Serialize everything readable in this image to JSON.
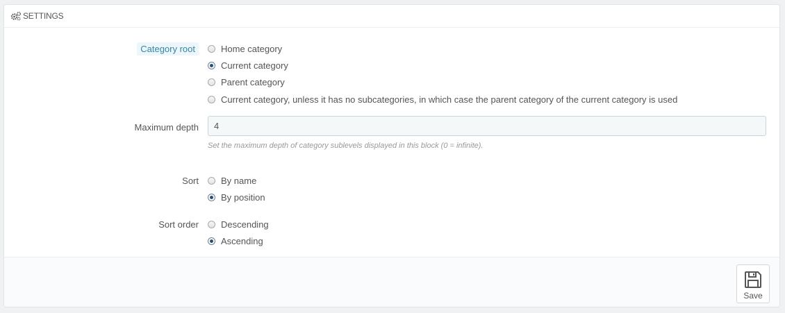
{
  "header": {
    "title": "Settings",
    "icon": "cogs-icon"
  },
  "category_root": {
    "label": "Category root",
    "options": [
      {
        "label": "Home category",
        "checked": false
      },
      {
        "label": "Current category",
        "checked": true
      },
      {
        "label": "Parent category",
        "checked": false
      },
      {
        "label": "Current category, unless it has no subcategories, in which case the parent category of the current category is used",
        "checked": false
      }
    ]
  },
  "max_depth": {
    "label": "Maximum depth",
    "value": "4",
    "help": "Set the maximum depth of category sublevels displayed in this block (0 = infinite)."
  },
  "sort": {
    "label": "Sort",
    "options": [
      {
        "label": "By name",
        "checked": false
      },
      {
        "label": "By position",
        "checked": true
      }
    ]
  },
  "sort_order": {
    "label": "Sort order",
    "options": [
      {
        "label": "Descending",
        "checked": false
      },
      {
        "label": "Ascending",
        "checked": true
      }
    ]
  },
  "footer": {
    "save_label": "Save",
    "save_icon": "floppy-disk-icon"
  },
  "colors": {
    "accent": "#3585a5",
    "highlight_bg": "#edf7fb",
    "radio_checked": "#2a4f76"
  }
}
